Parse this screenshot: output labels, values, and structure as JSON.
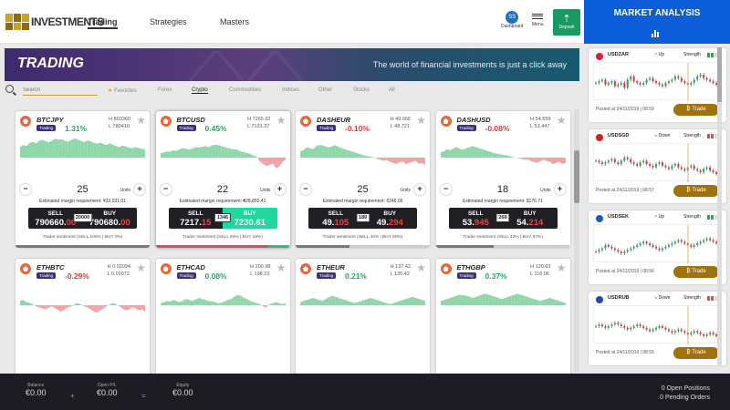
{
  "nav": {
    "brand": "INVESTMENTS",
    "tabs": [
      "Trading",
      "Strategies",
      "Masters"
    ],
    "avatar_initials": "SS",
    "dashboard_label": "Dashboard",
    "menu_label": "Menu",
    "deposit_label": "Deposit"
  },
  "banner": {
    "title": "TRADING",
    "subtitle": "The world of financial investments is just a click away"
  },
  "filter": {
    "search_placeholder": "Search",
    "tabs": [
      "Favorites",
      "Forex",
      "Crypto",
      "Commodities",
      "Indices",
      "Other",
      "Stocks",
      "All"
    ],
    "active_tab": "Crypto"
  },
  "cards": [
    {
      "symbol": "BTCJPY",
      "tag": "Trading",
      "change": "1.31%",
      "dir": "up",
      "high": "H 803360",
      "low": "L 780410",
      "units": "25",
      "units_label": "Units",
      "margin": "Estimated margin requirement: ¥33,031.01",
      "sell_label": "SELL",
      "sell_main": "790660.",
      "sell_red": "00",
      "spread": "20000",
      "buy_label": "BUY",
      "buy_main": "790680.",
      "buy_red": "00",
      "sentiment": "Trader sentiment (SELL 100% | BUY 0%)",
      "sent_sell": 100,
      "buy_hl": false,
      "series": [
        0.5,
        0.6,
        0.55,
        0.7,
        0.75,
        0.68,
        0.8,
        0.85,
        0.78,
        0.72,
        0.82,
        0.9,
        0.85,
        0.88,
        0.8,
        0.76,
        0.84,
        0.92,
        0.86,
        0.8,
        0.74,
        0.82,
        0.78,
        0.7,
        0.66,
        0.72,
        0.65,
        0.6,
        0.68,
        0.62,
        0.55,
        0.5,
        0.58,
        0.52,
        0.48,
        0.44,
        0.5,
        0.46,
        0.42,
        0.38
      ]
    },
    {
      "symbol": "BTCUSD",
      "tag": "Trading",
      "change": "0.45%",
      "dir": "up",
      "high": "H 7265.92",
      "low": "L 7131.37",
      "units": "22",
      "units_label": "Units",
      "margin": "Estimated margin requirement: ₴28,850.41",
      "sell_label": "SELL",
      "sell_main": "7217.",
      "sell_red": "15",
      "spread": "1346",
      "buy_label": "BUY",
      "buy_main": "7230.",
      "buy_red": "61",
      "sentiment": "Trader sentiment (SELL 84% | BUY 16%)",
      "sent_sell": 84,
      "buy_hl": true,
      "series": [
        0.2,
        0.25,
        0.3,
        0.28,
        0.35,
        0.32,
        0.4,
        0.45,
        0.42,
        0.38,
        0.44,
        0.5,
        0.47,
        0.52,
        0.55,
        0.5,
        0.58,
        0.62,
        0.6,
        0.55,
        0.5,
        0.46,
        0.42,
        0.4,
        0.38,
        0.3,
        0.26,
        0.22,
        0.18,
        0.1,
        0.05,
        -0.2,
        -0.3,
        -0.4,
        -0.35,
        -0.28,
        -0.5,
        -0.42,
        -0.2,
        -0.1
      ]
    },
    {
      "symbol": "DASHEUR",
      "tag": "Trading",
      "change": "-0.10%",
      "dir": "dn",
      "high": "H 49.666",
      "low": "L 48.721",
      "units": "25",
      "units_label": "Units",
      "margin": "Estimated margin requirement: €246.00",
      "sell_label": "SELL",
      "sell_main": "49.",
      "sell_red": "105",
      "spread": "189",
      "buy_label": "BUY",
      "buy_main": "49.",
      "buy_red": "294",
      "sentiment": "Trader sentiment (SELL 40% | BUY 60%)",
      "sent_sell": 40,
      "buy_hl": false,
      "series": [
        0.3,
        0.35,
        0.5,
        0.45,
        0.4,
        0.55,
        0.6,
        0.58,
        0.52,
        0.48,
        0.55,
        0.6,
        0.5,
        0.45,
        0.4,
        0.35,
        0.3,
        0.25,
        0.2,
        0.15,
        0.1,
        0.08,
        0.05,
        0.02,
        -0.05,
        -0.1,
        -0.15,
        -0.12,
        -0.2,
        -0.25,
        -0.3,
        -0.22,
        -0.18,
        -0.3,
        -0.25,
        -0.2,
        -0.15,
        -0.3,
        -0.25,
        -0.35
      ]
    },
    {
      "symbol": "DASHUSD",
      "tag": "Trading",
      "change": "-0.08%",
      "dir": "dn",
      "high": "H 54.559",
      "low": "L 53.447",
      "units": "18",
      "units_label": "Units",
      "margin": "Estimated margin requirement: $176.71",
      "sell_label": "SELL",
      "sell_main": "53.",
      "sell_red": "945",
      "spread": "269",
      "buy_label": "BUY",
      "buy_main": "54.",
      "buy_red": "214",
      "sentiment": "Trader sentiment (SELL 43% | BUY 57%)",
      "sent_sell": 43,
      "buy_hl": false,
      "series": [
        0.25,
        0.3,
        0.4,
        0.35,
        0.45,
        0.5,
        0.42,
        0.38,
        0.45,
        0.5,
        0.55,
        0.5,
        0.45,
        0.4,
        0.35,
        0.3,
        0.25,
        0.2,
        0.18,
        0.15,
        0.12,
        0.1,
        0.05,
        0.02,
        -0.02,
        -0.05,
        -0.1,
        -0.08,
        -0.15,
        -0.2,
        -0.25,
        -0.18,
        -0.1,
        -0.15,
        -0.2,
        -0.3,
        -0.25,
        -0.2,
        -0.3,
        -0.25
      ]
    },
    {
      "symbol": "ETHBTC",
      "tag": "Trading",
      "change": "-0.29%",
      "dir": "dn",
      "high": "H 0.02094",
      "low": "L 0.02072",
      "units": "",
      "series": [
        0.2,
        0.25,
        0.15,
        0.1,
        0.05,
        -0.05,
        -0.1,
        -0.15,
        -0.2,
        -0.1,
        -0.05,
        -0.15,
        -0.25,
        -0.3,
        -0.2,
        -0.1,
        -0.05,
        0.05,
        0.1,
        0.05,
        -0.05,
        -0.1,
        -0.2,
        -0.3,
        -0.35,
        -0.25,
        -0.15,
        -0.05,
        0.05,
        0.1,
        0.05,
        -0.05,
        -0.15,
        -0.25,
        -0.2,
        -0.1,
        -0.15,
        -0.25,
        -0.2,
        -0.3
      ]
    },
    {
      "symbol": "ETHCAD",
      "tag": "Trading",
      "change": "0.08%",
      "dir": "up",
      "high": "H 200.98",
      "low": "L 198.23",
      "units": "",
      "series": [
        0.1,
        0.15,
        0.2,
        0.18,
        0.25,
        0.2,
        0.15,
        0.22,
        0.3,
        0.25,
        0.2,
        0.28,
        0.35,
        0.3,
        0.25,
        0.2,
        0.18,
        0.15,
        0.1,
        0.12,
        0.18,
        0.25,
        0.3,
        0.4,
        0.5,
        0.45,
        0.35,
        0.3,
        0.2,
        0.15,
        0.1,
        0.05,
        -0.05,
        -0.1,
        0.05,
        0.1,
        0.15,
        0.1,
        0.05,
        0.1
      ]
    },
    {
      "symbol": "ETHEUR",
      "tag": "Trading",
      "change": "0.21%",
      "dir": "up",
      "high": "H 137.42",
      "low": "L 135.42",
      "units": "",
      "series": [
        0.15,
        0.2,
        0.25,
        0.3,
        0.35,
        0.3,
        0.25,
        0.2,
        0.3,
        0.38,
        0.45,
        0.4,
        0.35,
        0.3,
        0.25,
        0.2,
        0.15,
        0.1,
        0.15,
        0.2,
        0.25,
        0.3,
        0.35,
        0.3,
        0.25,
        0.2,
        0.15,
        0.1,
        0.05,
        0.1,
        0.15,
        0.2,
        0.25,
        0.3,
        0.35,
        0.4,
        0.35,
        0.3,
        0.25,
        0.2
      ]
    },
    {
      "symbol": "ETHGBP",
      "tag": "Trading",
      "change": "0.37%",
      "dir": "up",
      "high": "H 120.63",
      "low": "L 116.06",
      "units": "",
      "series": [
        0.2,
        0.25,
        0.3,
        0.35,
        0.4,
        0.45,
        0.5,
        0.48,
        0.45,
        0.4,
        0.35,
        0.4,
        0.45,
        0.5,
        0.55,
        0.5,
        0.45,
        0.4,
        0.35,
        0.3,
        0.35,
        0.4,
        0.45,
        0.5,
        0.55,
        0.5,
        0.45,
        0.4,
        0.35,
        0.3,
        0.25,
        0.2,
        0.25,
        0.3,
        0.35,
        0.3,
        0.25,
        0.2,
        0.15,
        0.1
      ]
    }
  ],
  "market": {
    "title": "MARKET ANALYSIS",
    "items": [
      {
        "symbol": "USDZAR",
        "direction": "Up",
        "dir_arrow": "↗",
        "strength": "Strength",
        "date": "Posted at 24/11/2019 | 08:59",
        "button": "₿ Trade",
        "flag_color": "#d23",
        "series": [
          0.5,
          0.55,
          0.6,
          0.45,
          0.5,
          0.55,
          0.4,
          0.45,
          0.5,
          0.35,
          0.6,
          0.7,
          0.55,
          0.5,
          0.45,
          0.5,
          0.6,
          0.65,
          0.55,
          0.5,
          0.45,
          0.4,
          0.5,
          0.55,
          0.6,
          0.7,
          0.65,
          0.55,
          0.5,
          0.45,
          0.5,
          0.6,
          0.7,
          0.75,
          0.65,
          0.6,
          0.55,
          0.5,
          0.45,
          0.4
        ]
      },
      {
        "symbol": "USDSGD",
        "direction": "Down",
        "dir_arrow": "↘",
        "strength": "Strength",
        "date": "Posted at 24/11/2019 | 08:57",
        "button": "₿ Trade",
        "flag_color": "#c22",
        "series": [
          0.6,
          0.55,
          0.5,
          0.55,
          0.6,
          0.65,
          0.55,
          0.5,
          0.6,
          0.7,
          0.65,
          0.55,
          0.5,
          0.45,
          0.55,
          0.6,
          0.5,
          0.45,
          0.4,
          0.5,
          0.55,
          0.45,
          0.4,
          0.35,
          0.45,
          0.5,
          0.4,
          0.35,
          0.3,
          0.4,
          0.45,
          0.35,
          0.3,
          0.25,
          0.35,
          0.4,
          0.3,
          0.25,
          0.2,
          0.3
        ]
      },
      {
        "symbol": "USDSEK",
        "direction": "Up",
        "dir_arrow": "↗",
        "strength": "Strength",
        "date": "Posted at 24/11/2019 | 08:56",
        "button": "₿ Trade",
        "flag_color": "#1a5cb8",
        "series": [
          0.3,
          0.35,
          0.4,
          0.5,
          0.45,
          0.4,
          0.35,
          0.3,
          0.25,
          0.3,
          0.35,
          0.4,
          0.45,
          0.5,
          0.55,
          0.6,
          0.55,
          0.5,
          0.45,
          0.4,
          0.35,
          0.4,
          0.45,
          0.5,
          0.55,
          0.6,
          0.65,
          0.6,
          0.55,
          0.5,
          0.45,
          0.5,
          0.55,
          0.6,
          0.65,
          0.7,
          0.65,
          0.6,
          0.55,
          0.5
        ]
      },
      {
        "symbol": "USDRUB",
        "direction": "Down",
        "dir_arrow": "↘",
        "strength": "Strength",
        "date": "Posted at 24/11/2019 | 08:55",
        "button": "₿ Trade",
        "flag_color": "#2149a8",
        "series": [
          0.5,
          0.55,
          0.5,
          0.45,
          0.5,
          0.55,
          0.6,
          0.55,
          0.5,
          0.45,
          0.4,
          0.45,
          0.5,
          0.55,
          0.5,
          0.45,
          0.4,
          0.35,
          0.4,
          0.45,
          0.5,
          0.45,
          0.4,
          0.35,
          0.3,
          0.35,
          0.4,
          0.35,
          0.3,
          0.25,
          0.3,
          0.35,
          0.3,
          0.25,
          0.2,
          0.25,
          0.3,
          0.25,
          0.2,
          0.15
        ]
      }
    ]
  },
  "footer": {
    "balance_label": "Balance",
    "balance": "€0.00",
    "pl_label": "Open P/L",
    "pl": "€0.00",
    "equity_label": "Equity",
    "equity": "€0.00",
    "plus": "+",
    "eq": "=",
    "positions": "0 Open Positions",
    "orders": "0 Pending Orders"
  }
}
